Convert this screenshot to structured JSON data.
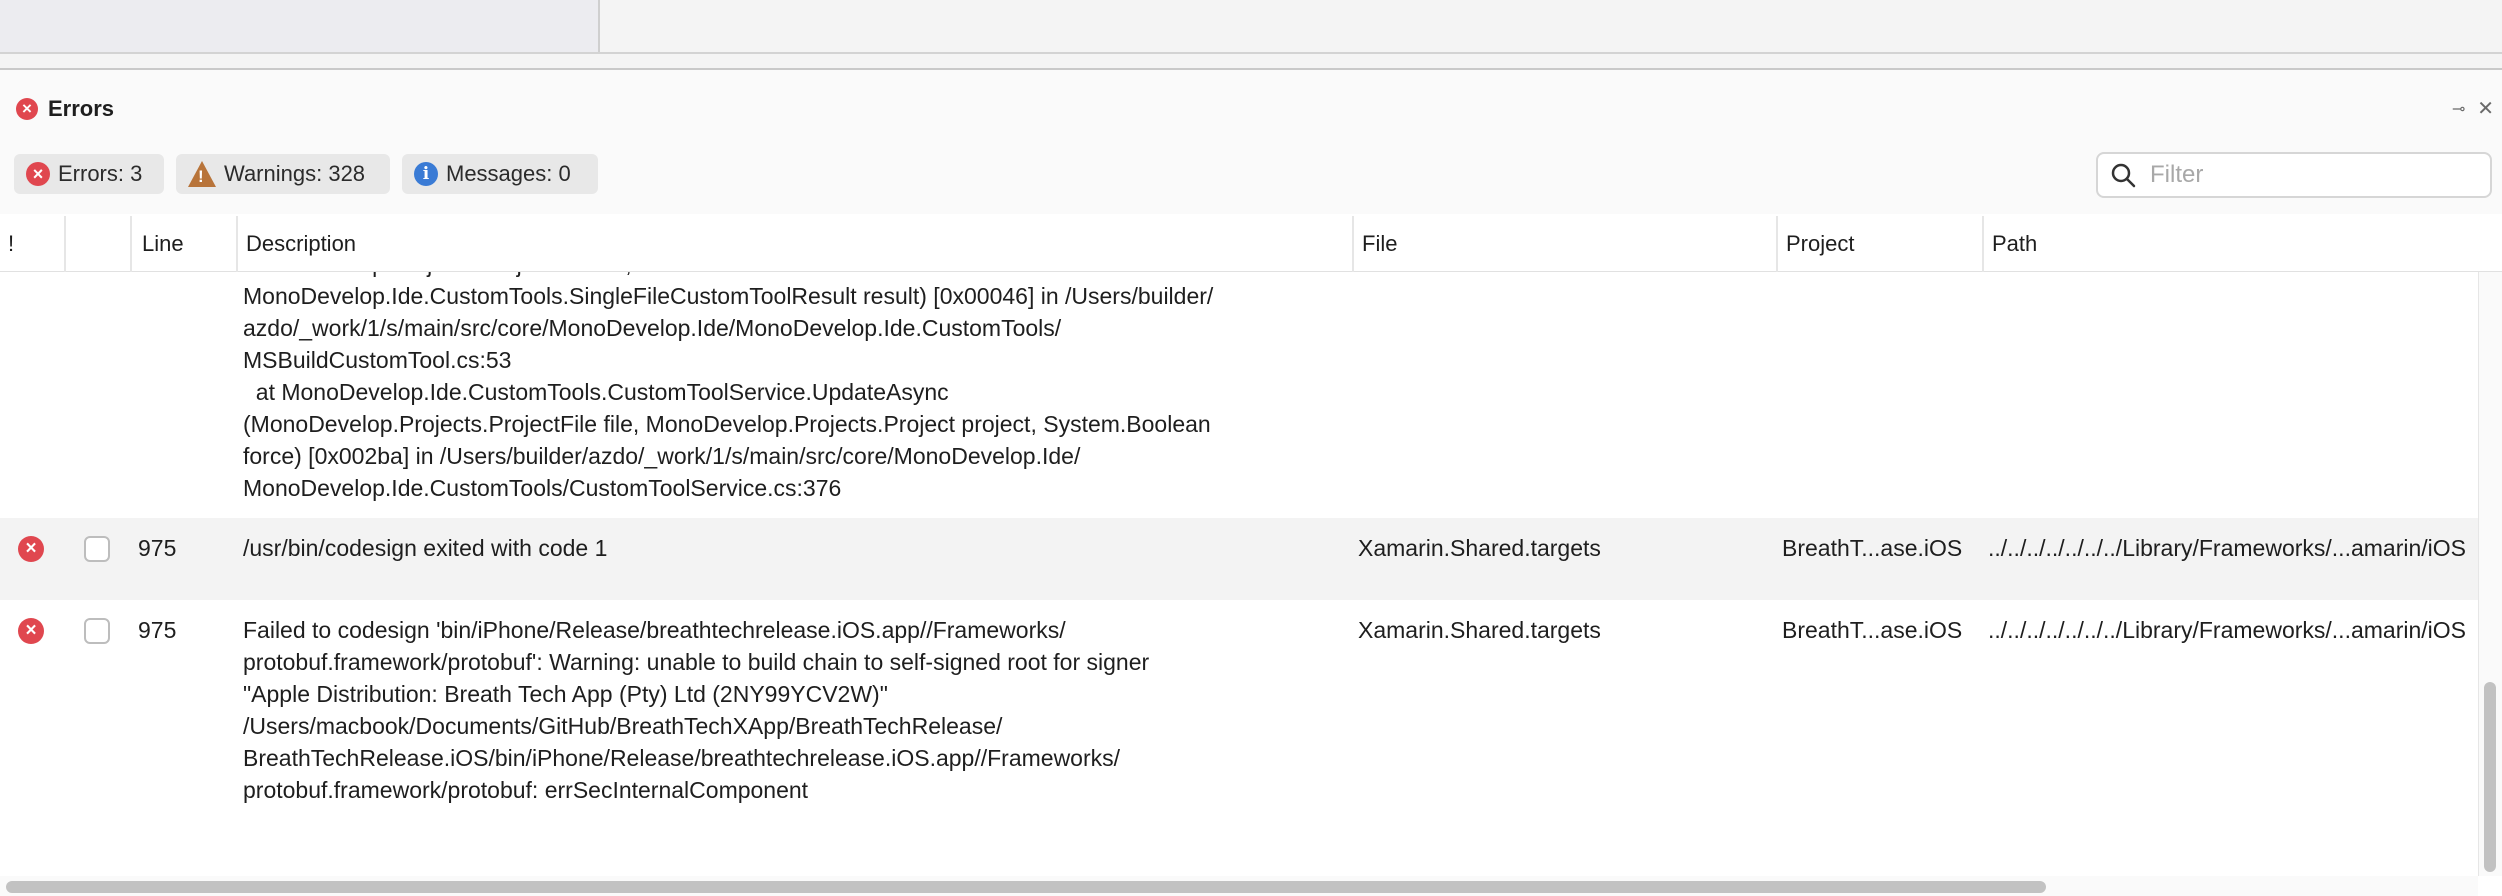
{
  "pad": {
    "title": "Errors"
  },
  "filters": {
    "errors_label": "Errors: 3",
    "warnings_label": "Warnings: 328",
    "messages_label": "Messages: 0",
    "search_placeholder": "Filter"
  },
  "columns": {
    "bang": "!",
    "line": "Line",
    "description": "Description",
    "file": "File",
    "project": "Project",
    "path": "Path"
  },
  "rows": [
    {
      "description": "MonoDevelop.Projects.ProjectFile file,\nMonoDevelop.Ide.CustomTools.SingleFileCustomToolResult result) [0x00046] in /Users/builder/\nazdo/_work/1/s/main/src/core/MonoDevelop.Ide/MonoDevelop.Ide.CustomTools/\nMSBuildCustomTool.cs:53\n  at MonoDevelop.Ide.CustomTools.CustomToolService.UpdateAsync\n(MonoDevelop.Projects.ProjectFile file, MonoDevelop.Projects.Project project, System.Boolean\nforce) [0x002ba] in /Users/builder/azdo/_work/1/s/main/src/core/MonoDevelop.Ide/\nMonoDevelop.Ide.CustomTools/CustomToolService.cs:376"
    },
    {
      "line": "975",
      "description": "/usr/bin/codesign exited with code 1",
      "file": "Xamarin.Shared.targets",
      "project": "BreathT...ase.iOS",
      "path": "../../../../../../../Library/Frameworks/...amarin/iOS"
    },
    {
      "line": "975",
      "description": "Failed to codesign 'bin/iPhone/Release/breathtechrelease.iOS.app//Frameworks/\nprotobuf.framework/protobuf': Warning: unable to build chain to self-signed root for signer\n\"Apple Distribution: Breath Tech App (Pty) Ltd (2NY99YCV2W)\"\n/Users/macbook/Documents/GitHub/BreathTechXApp/BreathTechRelease/\nBreathTechRelease.iOS/bin/iPhone/Release/breathtechrelease.iOS.app//Frameworks/\nprotobuf.framework/protobuf: errSecInternalComponent",
      "file": "Xamarin.Shared.targets",
      "project": "BreathT...ase.iOS",
      "path": "../../../../../../../Library/Frameworks/...amarin/iOS"
    }
  ],
  "icons": {
    "error": "error-icon",
    "warning": "warning-icon",
    "info": "info-icon",
    "search": "search-icon",
    "pin": "pin-icon",
    "close": "close-icon"
  },
  "colors": {
    "error": "#e0474f",
    "warning": "#b8743a",
    "info": "#3a7bd5"
  }
}
